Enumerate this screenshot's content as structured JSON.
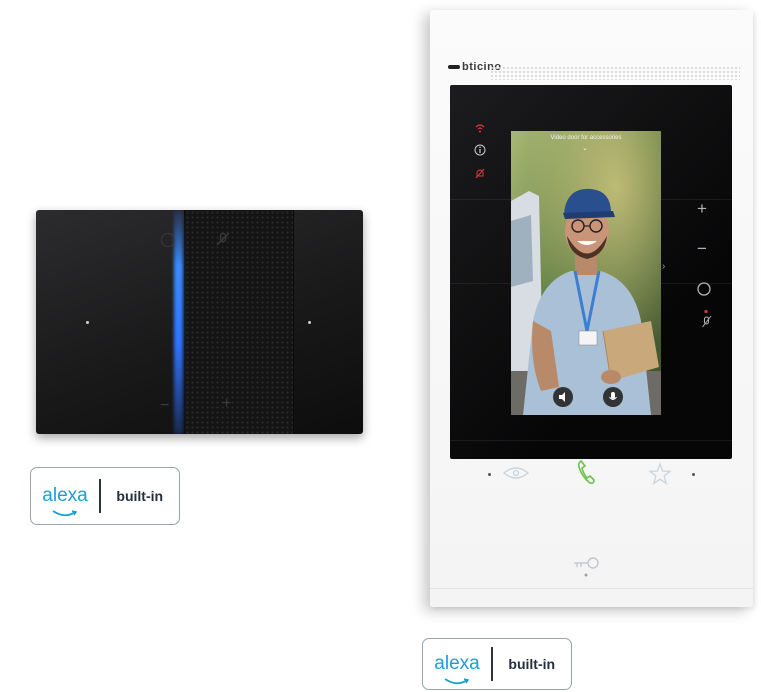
{
  "speaker": {
    "name": "smart-speaker-device",
    "accent": "#3c8cff",
    "body_color": "#19191a"
  },
  "speaker_badge": {
    "logo_text": "alexa",
    "built_in_text": "built-in"
  },
  "intercom": {
    "brand": "bticino",
    "camera_overlay_text": "Video door for accessories",
    "body_color": "#f6f6f6",
    "accent_red": "#d63a3a",
    "handset_green": "#6cc24a"
  },
  "intercom_badge": {
    "logo_text": "alexa",
    "built_in_text": "built-in"
  },
  "colors": {
    "alexa_blue": "#1a9fd4",
    "badge_border": "#9aa3ad"
  }
}
